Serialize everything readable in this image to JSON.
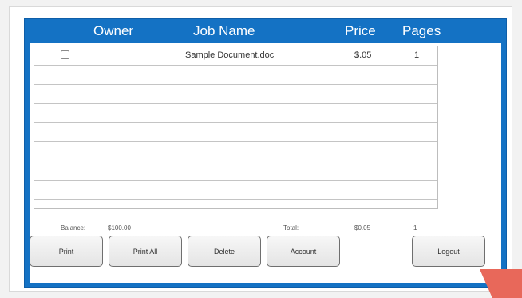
{
  "header": {
    "owner": "Owner",
    "job_name": "Job Name",
    "price": "Price",
    "pages": "Pages"
  },
  "jobs": [
    {
      "checked": false,
      "job_name": "Sample Document.doc",
      "price": "$.05",
      "pages": "1"
    }
  ],
  "summary": {
    "balance_label": "Balance:",
    "balance_value": "$100.00",
    "total_label": "Total:",
    "total_value": "$0.05",
    "total_pages": "1"
  },
  "buttons": {
    "print": "Print",
    "print_all": "Print All",
    "delete": "Delete",
    "account": "Account",
    "logout": "Logout"
  },
  "colors": {
    "panel_blue": "#1472c4",
    "header_text": "#ffffff",
    "corner_mark": "#e8685a"
  }
}
